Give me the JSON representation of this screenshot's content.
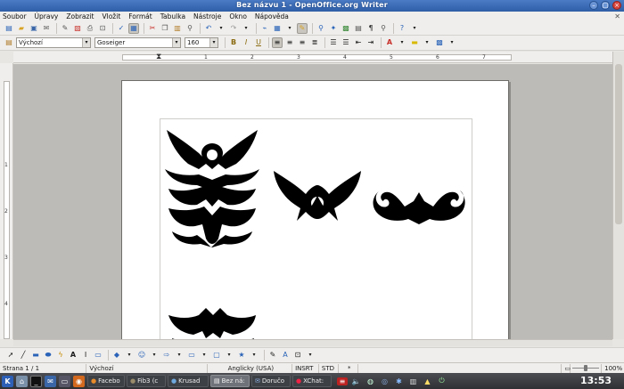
{
  "window": {
    "title": "Bez názvu 1 - OpenOffice.org Writer"
  },
  "menu": [
    "Soubor",
    "Úpravy",
    "Zobrazit",
    "Vložit",
    "Formát",
    "Tabulka",
    "Nástroje",
    "Okno",
    "Nápověda"
  ],
  "format_bar": {
    "style": "Výchozí",
    "font": "Goseiger",
    "size": "160"
  },
  "ruler": {
    "top_marks": [
      "1",
      "2",
      "3",
      "4",
      "5",
      "6",
      "7"
    ],
    "left_marks": [
      "1",
      "2",
      "3",
      "4"
    ]
  },
  "status": {
    "page": "Strana 1 / 1",
    "style": "Výchozí",
    "language": "Anglicky (USA)",
    "insert_mode": "INSRT",
    "selection_mode": "STD",
    "modified_marker": "*",
    "zoom": "100%"
  },
  "taskbar": {
    "tasks": [
      {
        "label": "Facebo",
        "icon": "firefox-icon",
        "active": false
      },
      {
        "label": "Fib3 (c",
        "icon": "gimp-icon",
        "active": false
      },
      {
        "label": "Krusad",
        "icon": "krusader-icon",
        "active": false
      },
      {
        "label": "Bez ná:",
        "icon": "writer-icon",
        "active": true
      },
      {
        "label": "Doručo",
        "icon": "mail-icon",
        "active": false
      },
      {
        "label": "XChat:",
        "icon": "chat-icon",
        "active": false
      }
    ],
    "clock": "13:53"
  },
  "colors": {
    "titlebar": "#2f5ea7",
    "workspace": "#bdbbb7",
    "taskbar": "#2e3034",
    "ornament": "#000000"
  }
}
